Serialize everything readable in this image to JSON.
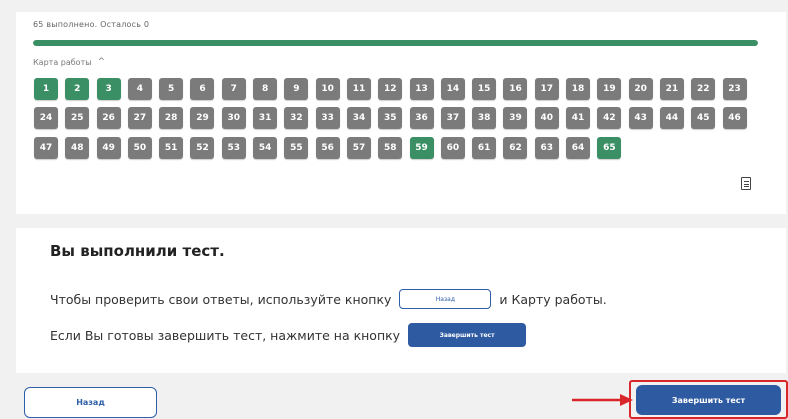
{
  "progress": {
    "text": "65 выполнено. Осталось 0",
    "fraction": 1.0
  },
  "map": {
    "toggle_label": "Карта работы",
    "toggle_icon": "chevron-up-icon",
    "done_color": "#3a8f64",
    "undone_color": "#7b7b7b",
    "cells": [
      {
        "n": "1",
        "done": true
      },
      {
        "n": "2",
        "done": true
      },
      {
        "n": "3",
        "done": true
      },
      {
        "n": "4",
        "done": false
      },
      {
        "n": "5",
        "done": false
      },
      {
        "n": "6",
        "done": false
      },
      {
        "n": "7",
        "done": false
      },
      {
        "n": "8",
        "done": false
      },
      {
        "n": "9",
        "done": false
      },
      {
        "n": "10",
        "done": false
      },
      {
        "n": "11",
        "done": false
      },
      {
        "n": "12",
        "done": false
      },
      {
        "n": "13",
        "done": false
      },
      {
        "n": "14",
        "done": false
      },
      {
        "n": "15",
        "done": false
      },
      {
        "n": "16",
        "done": false
      },
      {
        "n": "17",
        "done": false
      },
      {
        "n": "18",
        "done": false
      },
      {
        "n": "19",
        "done": false
      },
      {
        "n": "20",
        "done": false
      },
      {
        "n": "21",
        "done": false
      },
      {
        "n": "22",
        "done": false
      },
      {
        "n": "23",
        "done": false
      },
      {
        "n": "24",
        "done": false
      },
      {
        "n": "25",
        "done": false
      },
      {
        "n": "26",
        "done": false
      },
      {
        "n": "27",
        "done": false
      },
      {
        "n": "28",
        "done": false
      },
      {
        "n": "29",
        "done": false
      },
      {
        "n": "30",
        "done": false
      },
      {
        "n": "31",
        "done": false
      },
      {
        "n": "32",
        "done": false
      },
      {
        "n": "33",
        "done": false
      },
      {
        "n": "34",
        "done": false
      },
      {
        "n": "35",
        "done": false
      },
      {
        "n": "36",
        "done": false
      },
      {
        "n": "37",
        "done": false
      },
      {
        "n": "38",
        "done": false
      },
      {
        "n": "39",
        "done": false
      },
      {
        "n": "40",
        "done": false
      },
      {
        "n": "41",
        "done": false
      },
      {
        "n": "42",
        "done": false
      },
      {
        "n": "43",
        "done": false
      },
      {
        "n": "44",
        "done": false
      },
      {
        "n": "45",
        "done": false
      },
      {
        "n": "46",
        "done": false
      },
      {
        "n": "47",
        "done": false
      },
      {
        "n": "48",
        "done": false
      },
      {
        "n": "49",
        "done": false
      },
      {
        "n": "50",
        "done": false
      },
      {
        "n": "51",
        "done": false
      },
      {
        "n": "52",
        "done": false
      },
      {
        "n": "53",
        "done": false
      },
      {
        "n": "54",
        "done": false
      },
      {
        "n": "55",
        "done": false
      },
      {
        "n": "56",
        "done": false
      },
      {
        "n": "57",
        "done": false
      },
      {
        "n": "58",
        "done": false
      },
      {
        "n": "59",
        "done": true
      },
      {
        "n": "60",
        "done": false
      },
      {
        "n": "61",
        "done": false
      },
      {
        "n": "62",
        "done": false
      },
      {
        "n": "63",
        "done": false
      },
      {
        "n": "64",
        "done": false
      },
      {
        "n": "65",
        "done": true
      }
    ]
  },
  "summary_icon": "document-icon",
  "completion": {
    "title": "Вы выполнили тест.",
    "line1_before": "Чтобы проверить свои ответы, используйте кнопку",
    "line1_button": "Назад",
    "line1_after": "и Карту работы.",
    "line2_before": "Если Вы готовы завершить тест, нажмите на кнопку",
    "line2_button": "Завершить тест"
  },
  "footer": {
    "back_label": "Назад",
    "finish_label": "Завершить тест",
    "arrow_icon": "red-arrow-icon",
    "highlight_color": "#d8262a"
  }
}
